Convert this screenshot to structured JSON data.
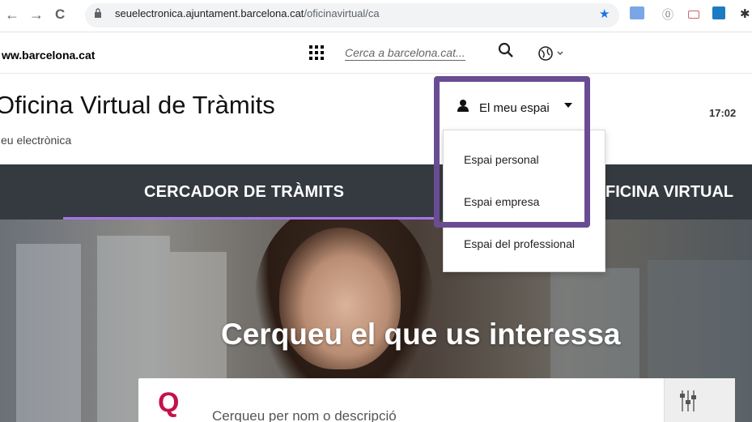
{
  "browser": {
    "back": "←",
    "forward": "→",
    "reload": "C",
    "url_host": "seuelectronica.ajuntament.barcelona.cat",
    "url_path": "/oficinavirtual/ca"
  },
  "site": {
    "link": "ww.barcelona.cat",
    "search_placeholder": "Cerca a barcelona.cat...",
    "title": "Oficina Virtual de Tràmits",
    "subtitle": "eu electrònica",
    "clock": "17:02"
  },
  "nav": {
    "tab1": "CERCADOR DE TRÀMITS",
    "tab2": "FICINA VIRTUAL"
  },
  "espai": {
    "label": "El meu espai",
    "items": [
      "Espai personal",
      "Espai empresa",
      "Espai del professional"
    ]
  },
  "hero": {
    "title": "Cerqueu el que us interessa",
    "search_placeholder": "Cerqueu per nom o descripció",
    "search_icon_glyph": "Q"
  },
  "colors": {
    "accent": "#a873e8",
    "highlight": "#6a4c93",
    "nav": "#343a40",
    "brand_red": "#c3124c"
  }
}
